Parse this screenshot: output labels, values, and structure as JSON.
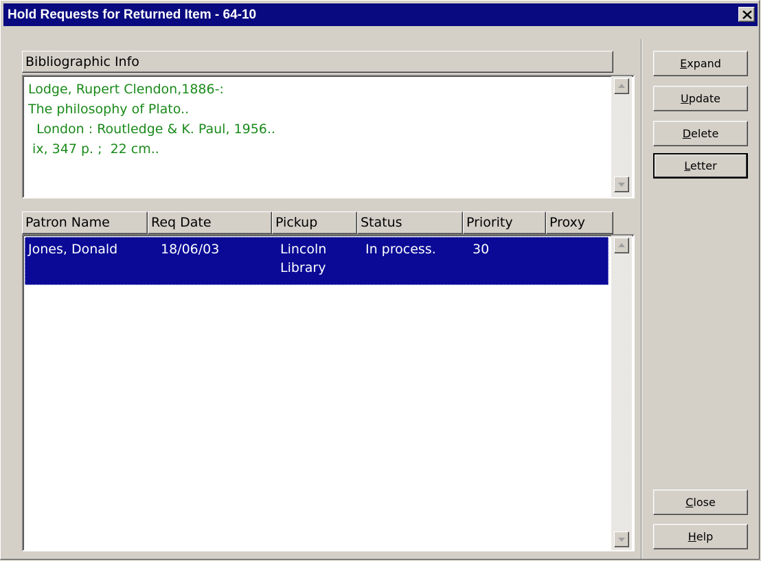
{
  "window": {
    "title": "Hold Requests for Returned Item - 64-10"
  },
  "bib": {
    "header": "Bibliographic Info",
    "lines": [
      "Lodge, Rupert Clendon,1886-:",
      "The philosophy of Plato..",
      "  London : Routledge & K. Paul, 1956..",
      " ix, 347 p. ;  22 cm.."
    ]
  },
  "table": {
    "columns": [
      "Patron Name",
      "Req Date",
      "Pickup",
      "Status",
      "Priority",
      "Proxy"
    ],
    "rows": [
      {
        "patron": "Jones, Donald",
        "req_date": "18/06/03",
        "pickup_line1": "Lincoln",
        "pickup_line2": "Library",
        "status": "In process.",
        "priority": "30",
        "proxy": ""
      }
    ]
  },
  "buttons": {
    "expand": {
      "accel": "E",
      "rest": "xpand"
    },
    "update": {
      "accel": "U",
      "rest": "pdate"
    },
    "delete": {
      "accel": "D",
      "rest": "elete"
    },
    "letter": {
      "accel": "L",
      "rest": "etter"
    },
    "close": {
      "accel": "C",
      "rest": "lose"
    },
    "help": {
      "accel": "H",
      "rest": "elp"
    }
  },
  "colors": {
    "title_bg": "#0a0a80",
    "bib_text": "#1a8a1a",
    "selection_bg": "#0a0a96",
    "face": "#d4d0c8"
  },
  "icons": {
    "title_close": "close-x-icon",
    "scroll_up": "scroll-up-arrow-icon",
    "scroll_down": "scroll-down-arrow-icon"
  }
}
